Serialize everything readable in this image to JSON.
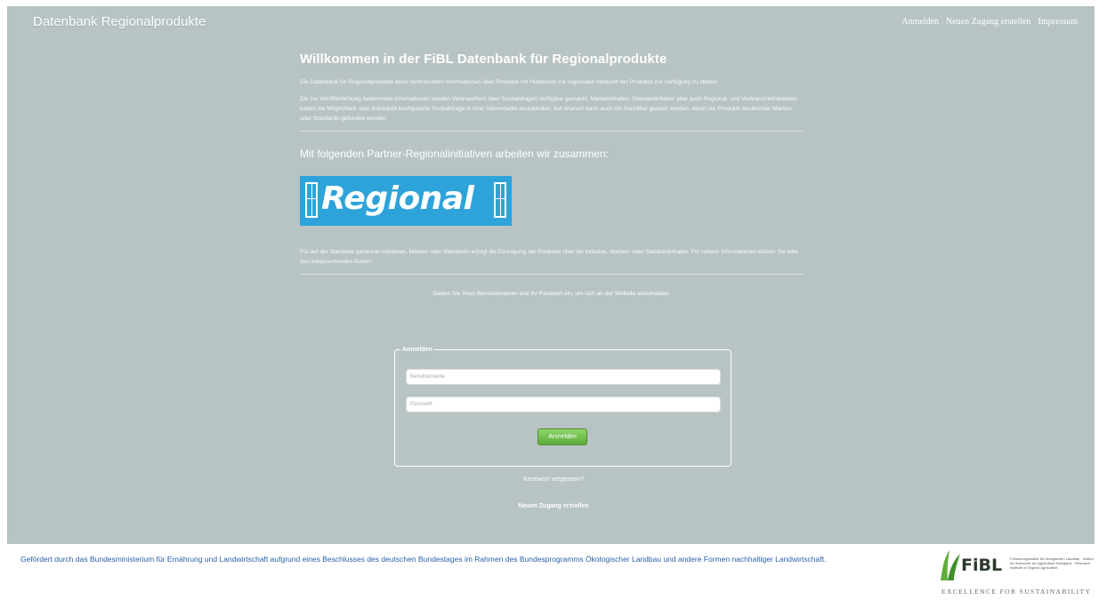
{
  "header": {
    "brand": "Datenbank Regionalprodukte",
    "nav": [
      "Anmelden",
      "Neuen Zugang erstellen",
      "Impressum"
    ]
  },
  "main": {
    "title": "Willkommen in der FiBL Datenbank für Regionalprodukte",
    "intro_p1": "Die Datenbank für Regionalprodukte dient Verbrauchern Informationen über Produkte mit Hinweisen zur regionalen Herkunft der Produkte zur Verfügung zu stellen.",
    "intro_p2": "Die zur Veröffentlichung bestimmten Informationen werden Verbrauchern über Suchanfragen verfügbar gemacht. Markeninhaber, Standardinhaber aber auch Regional- und Verbraucherinitiativen haben die Möglichkeit, eine individuell konfigurierte Suchabfrage in ihrer Internetseite einzubinden. Auf Wunsch kann auch ein Suchfilter gesetzt werden, damit nur Produkte bestimmter Marken oder Standards gefunden werden.",
    "partners_title": "Mit folgenden Partner-Regionalinitiativen arbeiten wir zusammen:",
    "partner_logo_text": "Regional",
    "partners_note": "Für auf der Startseite genannte Initiativen, Marken oder Standards erfolgt die Eintragung der Produkte über die Initiative, Marken- oder Standardinhaber. Für nähere Informationen klicken Sie bitte den entsprechenden Button.",
    "login_note": "Geben Sie Ihren Benutzernamen und Ihr Passwort ein, um sich an der Website anzumelden."
  },
  "login": {
    "legend": "Anmelden",
    "username_placeholder": "Benutzername",
    "password_placeholder": "Passwort",
    "submit_label": "Anmelden",
    "forgot_link": "Kennwort vergessen?",
    "new_account_link": "Neuen Zugang erstellen"
  },
  "footer": {
    "text": "Gefördert durch das Bundesministerium für Ernährung und Landwirtschaft aufgrund eines Beschlusses des deutschen Bundestages im Rahmen des Bundesprogramms Ökologischer Landbau und andere Formen nachhaltiger Landwirtschaft.",
    "fibl_name": "FiBL",
    "fibl_small": "Forschungsinstitut für biologischen Landbau · Institut de recherche de l'agriculture biologique · Research Institute of Organic Agriculture",
    "fibl_tagline": "EXCELLENCE FOR SUSTAINABILITY"
  },
  "colors": {
    "page_bg": "#b8c3c3",
    "link_blue": "#2a5ea8",
    "button_green": "#6cbf45",
    "partner_blue": "#2ea3d9"
  }
}
